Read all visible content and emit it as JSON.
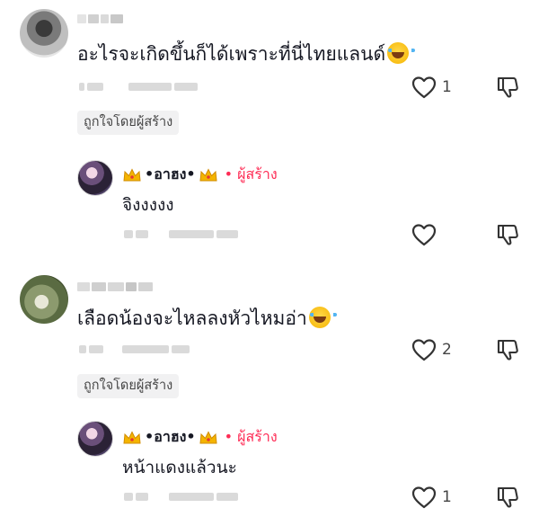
{
  "comments": [
    {
      "text": "อะไรจะเกิดขึ้นก็ได้เพราะที่นี่ไทยแลนด์",
      "emoji": "tears-of-joy-emoji",
      "like_count": "1",
      "creator_liked": "ถูกใจโดยผู้สร้าง",
      "reply": {
        "author": "•อาฮง•",
        "badge": "• ผู้สร้าง",
        "text": "จิงงงงง",
        "like_count": ""
      }
    },
    {
      "text": "เลือดน้องจะไหลลงหัวไหมอ่า",
      "emoji": "tears-of-joy-emoji",
      "like_count": "2",
      "creator_liked": "ถูกใจโดยผู้สร้าง",
      "reply": {
        "author": "•อาฮง•",
        "badge": "• ผู้สร้าง",
        "text": "หน้าแดงแล้วนะ",
        "like_count": "1"
      }
    }
  ],
  "icons": {
    "like": "heart-outline-icon",
    "dislike": "thumbs-down-icon",
    "crown": "crown-emoji"
  },
  "colors": {
    "creator_badge": "#fe2c55",
    "text": "#161823",
    "creator_liked_bg": "#f1f1f2"
  }
}
